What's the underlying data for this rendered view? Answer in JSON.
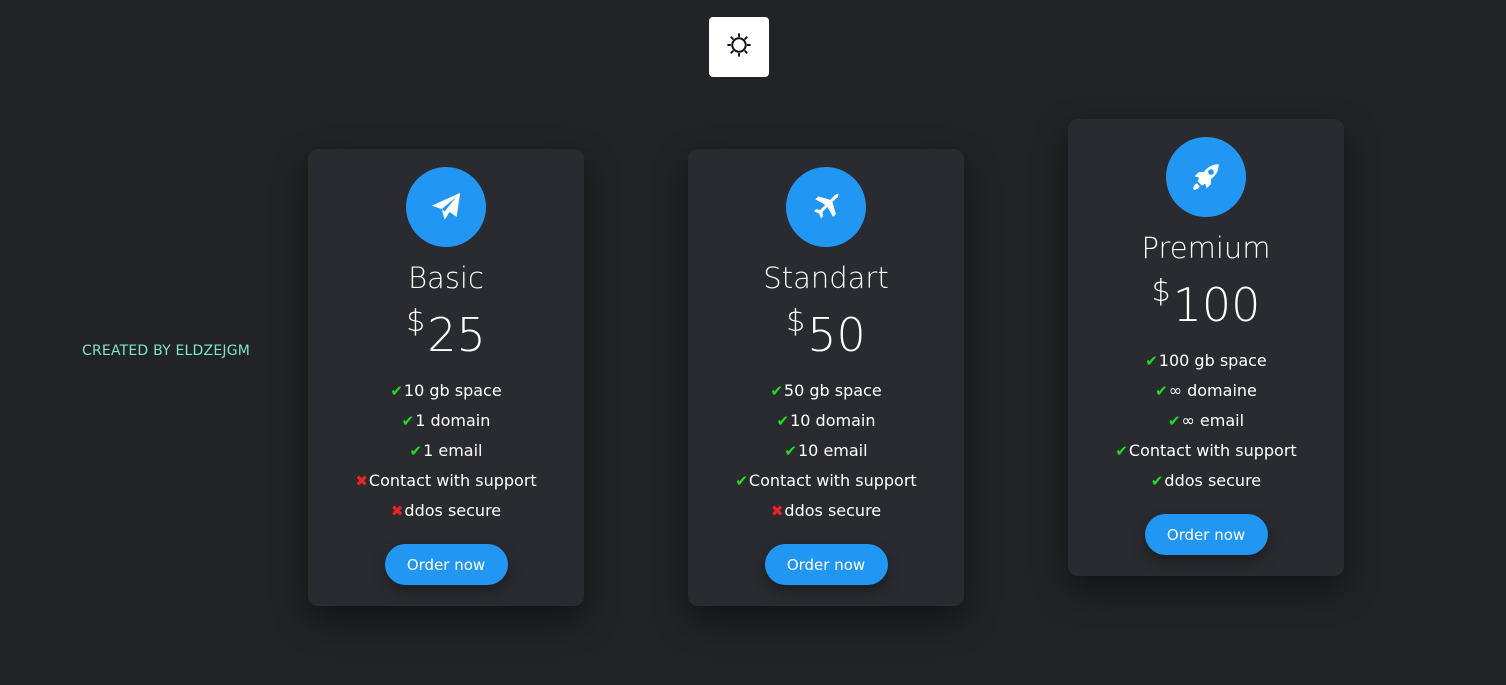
{
  "theme_toggle": {
    "icon": "sun-icon"
  },
  "credit": {
    "text": "CREATED BY ELDZEJGM"
  },
  "colors": {
    "accent": "#2196f3",
    "background": "#222326",
    "card": "#2a2b30",
    "check": "#22dd22",
    "cross": "#ee2222",
    "credit": "#7de8b8"
  },
  "plans": [
    {
      "icon": "paper-plane-icon",
      "name": "Basic",
      "currency": "$",
      "price": "25",
      "features": [
        {
          "ok": true,
          "mark": "✔",
          "text": "10 gb space"
        },
        {
          "ok": true,
          "mark": "✔",
          "text": "1 domain"
        },
        {
          "ok": true,
          "mark": "✔",
          "text": "1 email"
        },
        {
          "ok": false,
          "mark": "✖",
          "text": "Contact with support"
        },
        {
          "ok": false,
          "mark": "✖",
          "text": "ddos secure"
        }
      ],
      "button": "Order now"
    },
    {
      "icon": "plane-icon",
      "name": "Standart",
      "currency": "$",
      "price": "50",
      "features": [
        {
          "ok": true,
          "mark": "✔",
          "text": "50 gb space"
        },
        {
          "ok": true,
          "mark": "✔",
          "text": "10 domain"
        },
        {
          "ok": true,
          "mark": "✔",
          "text": "10 email"
        },
        {
          "ok": true,
          "mark": "✔",
          "text": "Contact with support"
        },
        {
          "ok": false,
          "mark": "✖",
          "text": "ddos secure"
        }
      ],
      "button": "Order now"
    },
    {
      "icon": "rocket-icon",
      "name": "Premium",
      "currency": "$",
      "price": "100",
      "features": [
        {
          "ok": true,
          "mark": "✔",
          "text": "100 gb space"
        },
        {
          "ok": true,
          "mark": "✔",
          "text": "∞ domaine"
        },
        {
          "ok": true,
          "mark": "✔",
          "text": "∞ email"
        },
        {
          "ok": true,
          "mark": "✔",
          "text": "Contact with support"
        },
        {
          "ok": true,
          "mark": "✔",
          "text": "ddos secure"
        }
      ],
      "button": "Order now"
    }
  ]
}
